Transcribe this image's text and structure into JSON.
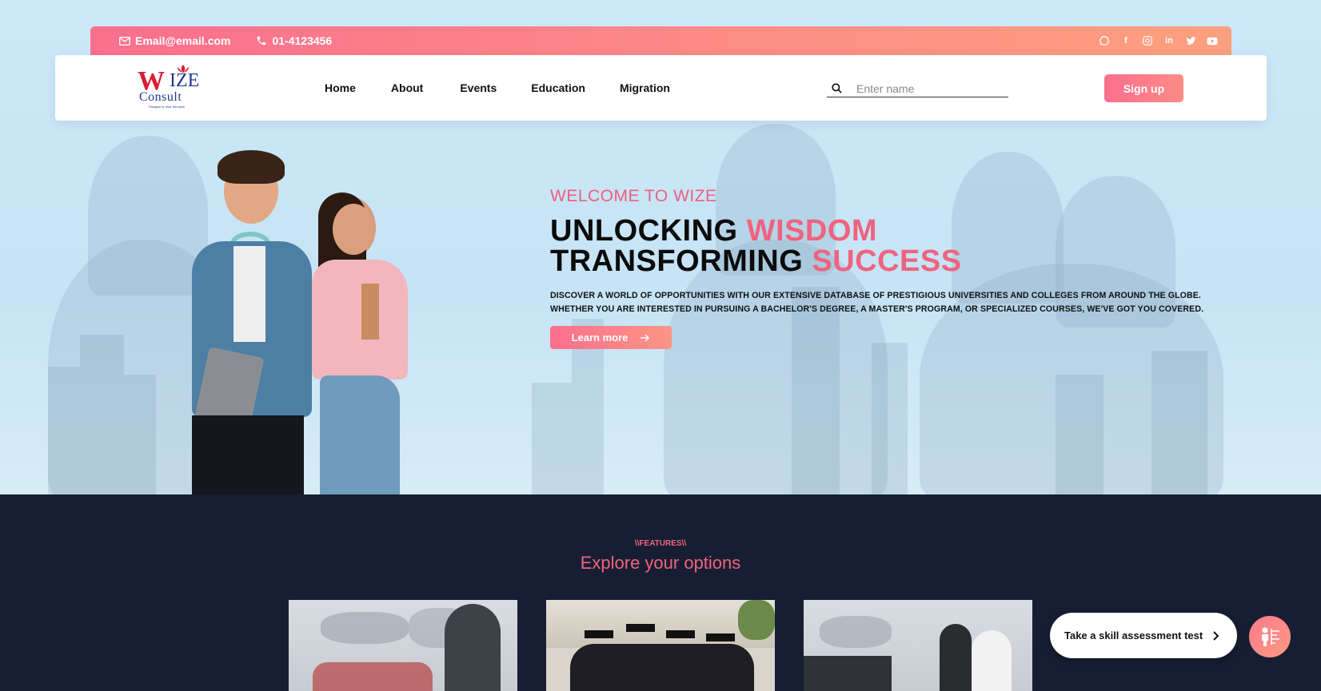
{
  "topbar": {
    "email": "Email@email.com",
    "phone": "01-4123456",
    "socials": [
      "whatsapp-icon",
      "facebook-icon",
      "instagram-icon",
      "linkedin-icon",
      "twitter-icon",
      "youtube-icon"
    ]
  },
  "logo": {
    "line1_a": "W",
    "line1_b": "IZE",
    "line2": "Consult",
    "tagline": "Passport & Visa Services"
  },
  "nav": {
    "items": [
      "Home",
      "About",
      "Events",
      "Education",
      "Migration"
    ]
  },
  "search": {
    "placeholder": "Enter name",
    "value": ""
  },
  "signup_label": "Sign up",
  "hero": {
    "welcome": "WELCOME TO WIZE",
    "line1_dark": "UNLOCKING ",
    "line1_pink": "WISDOM",
    "line2_dark": "TRANSFORMING ",
    "line2_pink": "SUCCESS",
    "desc1": "DISCOVER A WORLD OF OPPORTUNITIES WITH OUR EXTENSIVE DATABASE OF PRESTIGIOUS UNIVERSITIES AND COLLEGES FROM AROUND THE GLOBE.",
    "desc2": "WHETHER YOU ARE INTERESTED IN PURSUING A BACHELOR'S DEGREE, A MASTER'S PROGRAM, OR SPECIALIZED COURSES, WE'VE GOT YOU COVERED.",
    "cta": "Learn more"
  },
  "features": {
    "kicker": "\\\\FEATURES\\\\",
    "title": "Explore your options"
  },
  "skill_test": {
    "label": "Take a skill assessment test"
  },
  "colors": {
    "accent": "#f0637f",
    "dark": "#171e33",
    "hero_bg": "#cbe8f8"
  }
}
